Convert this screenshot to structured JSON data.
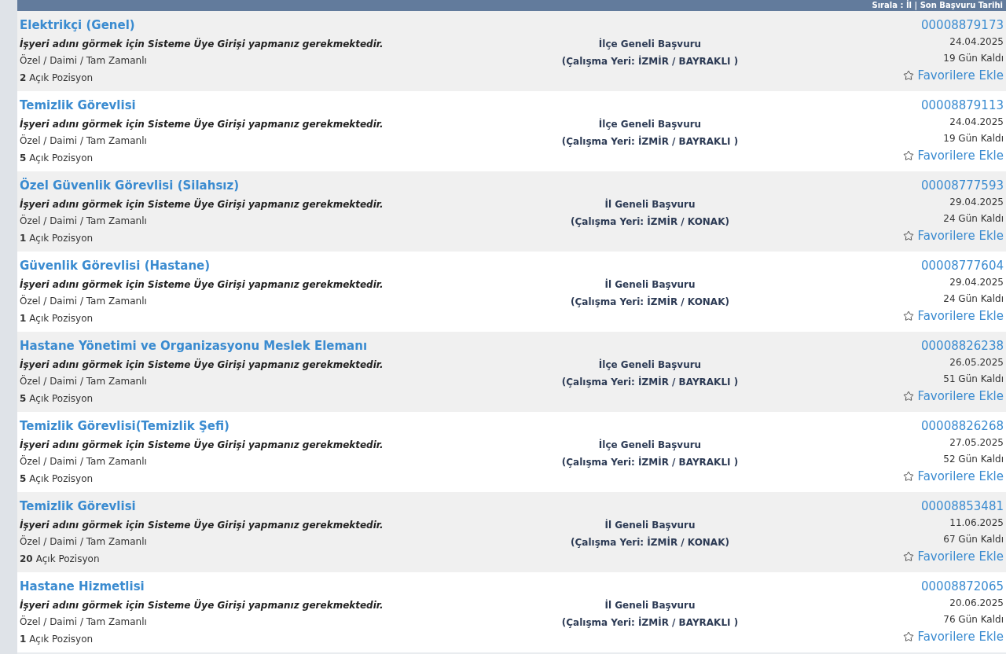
{
  "header": {
    "sort_text": "Sırala : İl | Son Başvuru Tarihi"
  },
  "jobs": [
    {
      "title": "Elektrikçi (Genel)",
      "notice": "İşyeri adını görmek için Sisteme Üye Girişi yapmanız gerekmektedir.",
      "type": "Özel / Daimi / Tam Zamanlı",
      "count": "2",
      "count_label": "Açık Pozisyon",
      "scope": "İlçe Geneli Başvuru",
      "location": "(Çalışma Yeri: İZMİR / BAYRAKLI )",
      "id": "00008879173",
      "date": "24.04.2025",
      "days_left": "19 Gün Kaldı",
      "favorite": "Favorilere Ekle"
    },
    {
      "title": "Temizlik Görevlisi",
      "notice": "İşyeri adını görmek için Sisteme Üye Girişi yapmanız gerekmektedir.",
      "type": "Özel / Daimi / Tam Zamanlı",
      "count": "5",
      "count_label": "Açık Pozisyon",
      "scope": "İlçe Geneli Başvuru",
      "location": "(Çalışma Yeri: İZMİR / BAYRAKLI )",
      "id": "00008879113",
      "date": "24.04.2025",
      "days_left": "19 Gün Kaldı",
      "favorite": "Favorilere Ekle"
    },
    {
      "title": "Özel Güvenlik Görevlisi (Silahsız)",
      "notice": "İşyeri adını görmek için Sisteme Üye Girişi yapmanız gerekmektedir.",
      "type": "Özel / Daimi / Tam Zamanlı",
      "count": "1",
      "count_label": "Açık Pozisyon",
      "scope": "İl Geneli Başvuru",
      "location": "(Çalışma Yeri: İZMİR / KONAK)",
      "id": "00008777593",
      "date": "29.04.2025",
      "days_left": "24 Gün Kaldı",
      "favorite": "Favorilere Ekle"
    },
    {
      "title": "Güvenlik Görevlisi (Hastane)",
      "notice": "İşyeri adını görmek için Sisteme Üye Girişi yapmanız gerekmektedir.",
      "type": "Özel / Daimi / Tam Zamanlı",
      "count": "1",
      "count_label": "Açık Pozisyon",
      "scope": "İl Geneli Başvuru",
      "location": "(Çalışma Yeri: İZMİR / KONAK)",
      "id": "00008777604",
      "date": "29.04.2025",
      "days_left": "24 Gün Kaldı",
      "favorite": "Favorilere Ekle"
    },
    {
      "title": "Hastane Yönetimi ve Organizasyonu Meslek Elemanı",
      "notice": "İşyeri adını görmek için Sisteme Üye Girişi yapmanız gerekmektedir.",
      "type": "Özel / Daimi / Tam Zamanlı",
      "count": "5",
      "count_label": "Açık Pozisyon",
      "scope": "İlçe Geneli Başvuru",
      "location": "(Çalışma Yeri: İZMİR / BAYRAKLI )",
      "id": "00008826238",
      "date": "26.05.2025",
      "days_left": "51 Gün Kaldı",
      "favorite": "Favorilere Ekle"
    },
    {
      "title": "Temizlik Görevlisi(Temizlik Şefi)",
      "notice": "İşyeri adını görmek için Sisteme Üye Girişi yapmanız gerekmektedir.",
      "type": "Özel / Daimi / Tam Zamanlı",
      "count": "5",
      "count_label": "Açık Pozisyon",
      "scope": "İlçe Geneli Başvuru",
      "location": "(Çalışma Yeri: İZMİR / BAYRAKLI )",
      "id": "00008826268",
      "date": "27.05.2025",
      "days_left": "52 Gün Kaldı",
      "favorite": "Favorilere Ekle"
    },
    {
      "title": "Temizlik Görevlisi",
      "notice": "İşyeri adını görmek için Sisteme Üye Girişi yapmanız gerekmektedir.",
      "type": "Özel / Daimi / Tam Zamanlı",
      "count": "20",
      "count_label": "Açık Pozisyon",
      "scope": "İl Geneli Başvuru",
      "location": "(Çalışma Yeri: İZMİR / KONAK)",
      "id": "00008853481",
      "date": "11.06.2025",
      "days_left": "67 Gün Kaldı",
      "favorite": "Favorilere Ekle"
    },
    {
      "title": "Hastane Hizmetlisi",
      "notice": "İşyeri adını görmek için Sisteme Üye Girişi yapmanız gerekmektedir.",
      "type": "Özel / Daimi / Tam Zamanlı",
      "count": "1",
      "count_label": "Açık Pozisyon",
      "scope": "İl Geneli Başvuru",
      "location": "(Çalışma Yeri: İZMİR / BAYRAKLI )",
      "id": "00008872065",
      "date": "20.06.2025",
      "days_left": "76 Gün Kaldı",
      "favorite": "Favorilere Ekle"
    }
  ]
}
